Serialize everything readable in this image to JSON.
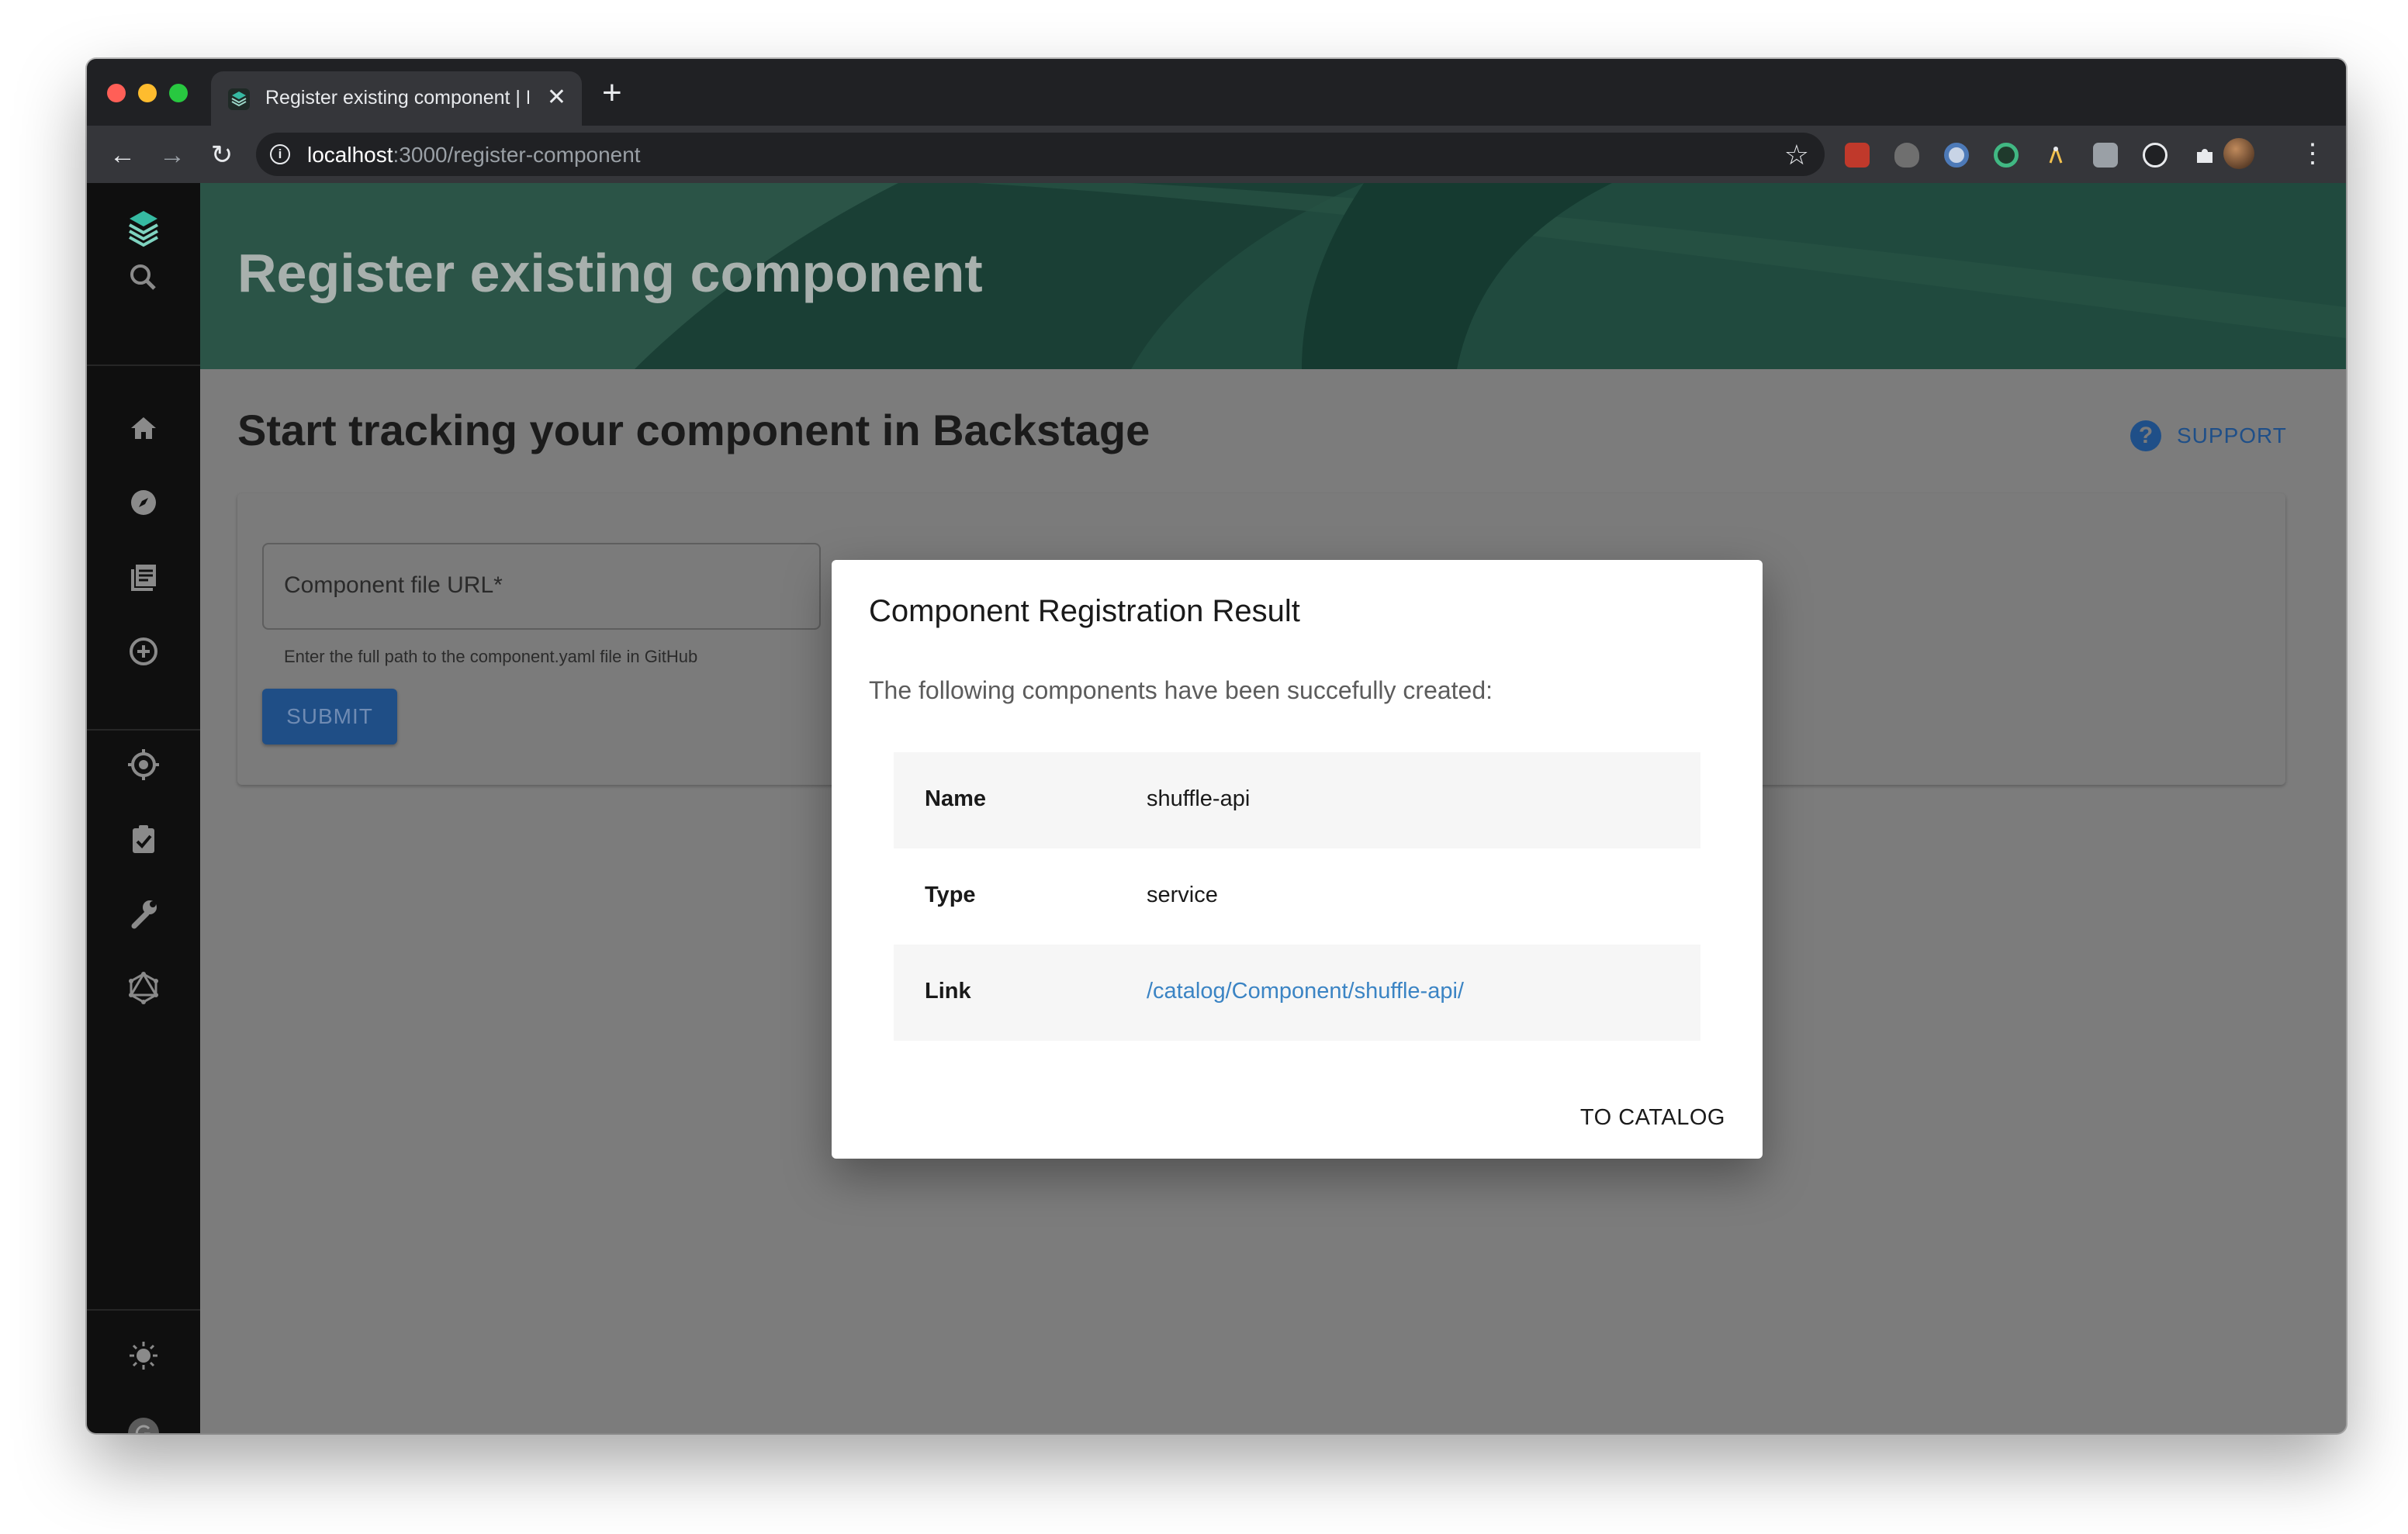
{
  "browser": {
    "tab_title": "Register existing component | Backstage",
    "new_tab": "+",
    "close_tab": "✕",
    "url_host": "localhost",
    "url_path": ":3000/register-component"
  },
  "header": {
    "title": "Register existing component"
  },
  "content": {
    "title": "Start tracking your component in Backstage",
    "support_label": "SUPPORT",
    "url_field_label": "Component file URL*",
    "url_helper": "Enter the full path to the component.yaml file in GitHub",
    "submit_label": "SUBMIT"
  },
  "dialog": {
    "title": "Component Registration Result",
    "text": "The following components have been succefully created:",
    "rows": [
      {
        "key": "Name",
        "value": "shuffle-api"
      },
      {
        "key": "Type",
        "value": "service"
      },
      {
        "key": "Link",
        "value": "/catalog/Component/shuffle-api/"
      }
    ],
    "action_label": "TO CATALOG"
  },
  "sidebar": {
    "icons": [
      "backstage-logo-icon",
      "search-icon",
      "home-icon",
      "explore-icon",
      "docs-icon",
      "create-icon",
      "tech-radar-icon",
      "tasks-icon",
      "tools-icon",
      "graphql-icon",
      "theme-sun-icon",
      "user-avatar-icon"
    ]
  },
  "colors": {
    "accent_blue": "#1f4e86",
    "link_blue": "#3b84c4",
    "sidebar_bg": "#0f0f0f",
    "header_green": "#1b4a3e"
  }
}
